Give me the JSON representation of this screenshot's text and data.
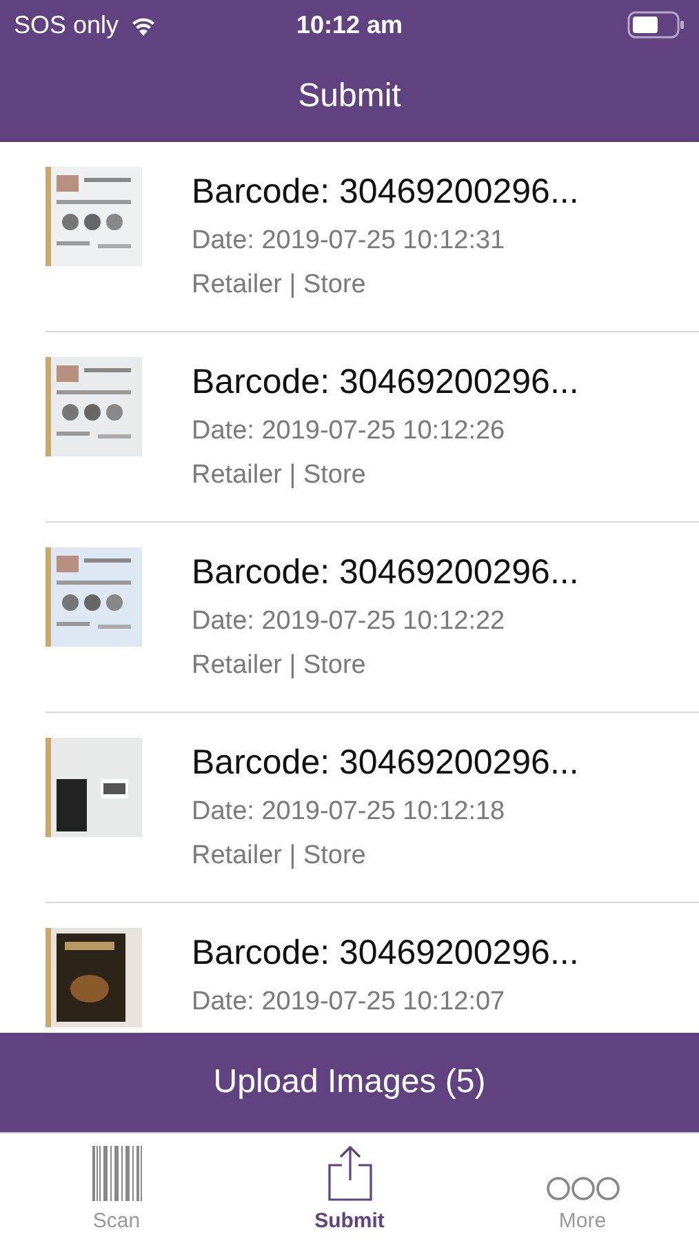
{
  "status_bar": {
    "carrier": "SOS only",
    "time": "10:12 am"
  },
  "header": {
    "title": "Submit"
  },
  "items": [
    {
      "barcode": "Barcode: 30469200296...",
      "date": "Date: 2019-07-25 10:12:31",
      "retailer": "Retailer | Store"
    },
    {
      "barcode": "Barcode: 30469200296...",
      "date": "Date: 2019-07-25 10:12:26",
      "retailer": "Retailer | Store"
    },
    {
      "barcode": "Barcode: 30469200296...",
      "date": "Date: 2019-07-25 10:12:22",
      "retailer": "Retailer | Store"
    },
    {
      "barcode": "Barcode: 30469200296...",
      "date": "Date: 2019-07-25 10:12:18",
      "retailer": "Retailer | Store"
    },
    {
      "barcode": "Barcode: 30469200296...",
      "date": "Date: 2019-07-25 10:12:07"
    }
  ],
  "upload_button": {
    "label": "Upload Images (5)"
  },
  "tab_bar": [
    {
      "label": "Scan",
      "kind": "barcode",
      "selected": false
    },
    {
      "label": "Submit",
      "kind": "share",
      "selected": true
    },
    {
      "label": "More",
      "kind": "more",
      "selected": false
    }
  ]
}
